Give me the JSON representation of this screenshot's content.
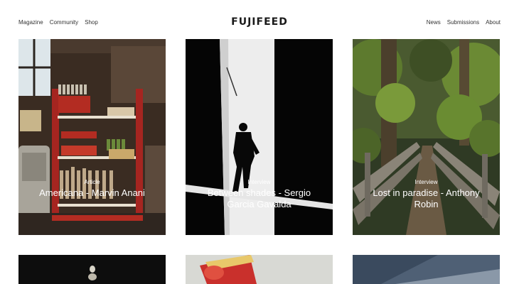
{
  "site": {
    "logo": "FUJIFEED"
  },
  "nav_left": [
    "Magazine",
    "Community",
    "Shop"
  ],
  "nav_right": [
    "News",
    "Submissions",
    "About"
  ],
  "cards": [
    {
      "badge": "Article",
      "title": "Americana - Marvin Anani"
    },
    {
      "badge": "Interview",
      "title": "Between shades - Sergio Garcia Gavalda"
    },
    {
      "badge": "Interview",
      "title": "Lost in paradise - Anthony Robin"
    }
  ]
}
